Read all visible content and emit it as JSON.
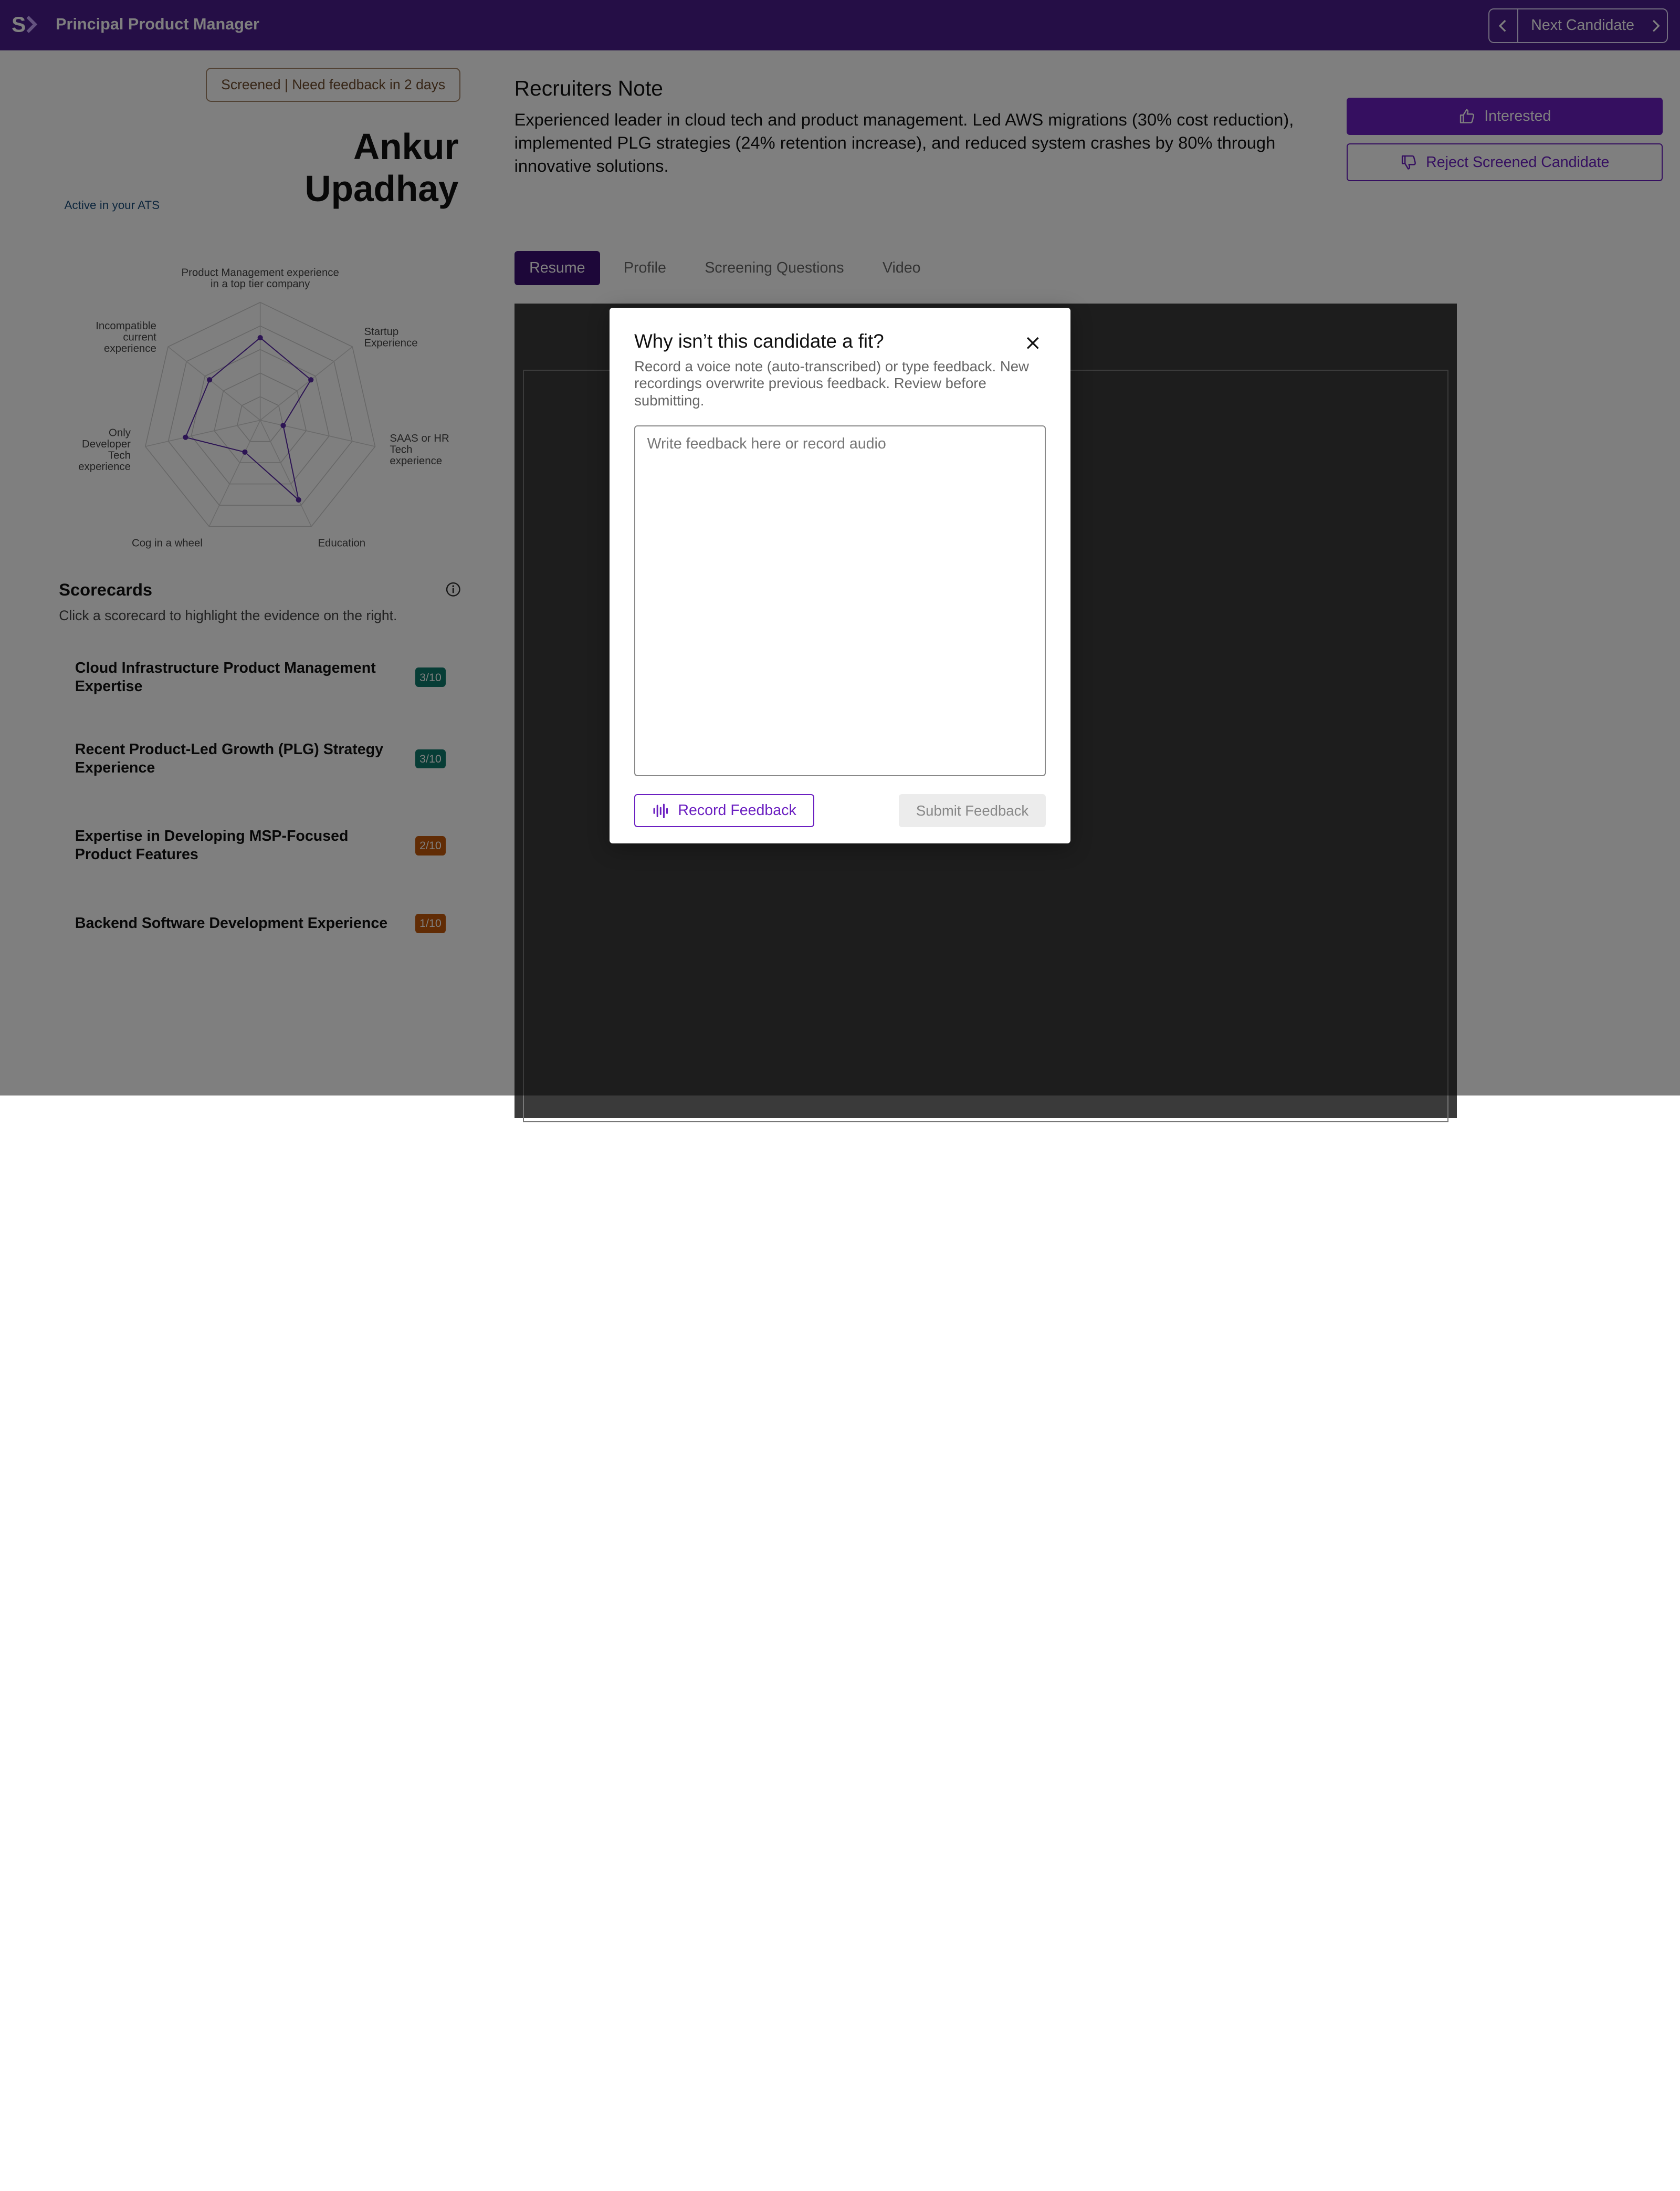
{
  "header": {
    "job_title": "Principal Product Manager",
    "next_candidate_label": "Next Candidate"
  },
  "candidate": {
    "status_badge": "Screened | Need feedback in 2 days",
    "name": "Ankur Upadhay",
    "ats_status": "Active in your ATS"
  },
  "radar": {
    "axes": [
      {
        "label_lines": [
          "Product Management experience",
          "in a top tier company"
        ],
        "value": 0.7
      },
      {
        "label_lines": [
          "Startup",
          "Experience"
        ],
        "value": 0.55
      },
      {
        "label_lines": [
          "SAAS or HR",
          "Tech",
          "experience"
        ],
        "value": 0.2
      },
      {
        "label_lines": [
          "Education"
        ],
        "value": 0.75
      },
      {
        "label_lines": [
          "Cog in a wheel"
        ],
        "value": 0.3
      },
      {
        "label_lines": [
          "Only",
          "Developer",
          "Tech",
          "experience"
        ],
        "value": 0.65
      },
      {
        "label_lines": [
          "Incompatible",
          "current",
          "experience"
        ],
        "value": 0.55
      }
    ],
    "line_color": "#5b2aa8"
  },
  "scorecards": {
    "title": "Scorecards",
    "hint": "Click a scorecard to highlight the evidence on the right.",
    "items": [
      {
        "name": "Cloud Infrastructure Product Management Expertise",
        "score": "3/10",
        "color": "#0f7b6c"
      },
      {
        "name": "Recent Product-Led Growth (PLG) Strategy Experience",
        "score": "3/10",
        "color": "#0f7b6c"
      },
      {
        "name": "Expertise in Developing MSP-Focused Product Features",
        "score": "2/10",
        "color": "#c2590a"
      },
      {
        "name": "Backend Software Development Experience",
        "score": "1/10",
        "color": "#c2590a"
      }
    ]
  },
  "recruiter": {
    "title": "Recruiters Note",
    "note": "Experienced leader in cloud tech and product management. Led AWS migrations (30% cost reduction), implemented PLG strategies (24% retention increase), and reduced system crashes by 80% through innovative solutions."
  },
  "actions": {
    "interested": "Interested",
    "reject": "Reject Screened Candidate"
  },
  "tabs": [
    {
      "label": "Resume",
      "active": true
    },
    {
      "label": "Profile",
      "active": false
    },
    {
      "label": "Screening Questions",
      "active": false
    },
    {
      "label": "Video",
      "active": false
    }
  ],
  "modal": {
    "title": "Why isn’t this candidate a fit?",
    "description": "Record a voice note (auto-transcribed) or type feedback. New recordings overwrite previous feedback. Review before submitting.",
    "placeholder": "Write feedback here or record audio",
    "record_label": "Record Feedback",
    "submit_label": "Submit Feedback"
  },
  "colors": {
    "brand": "#4a1d8c",
    "accent": "#6b1fc1"
  }
}
